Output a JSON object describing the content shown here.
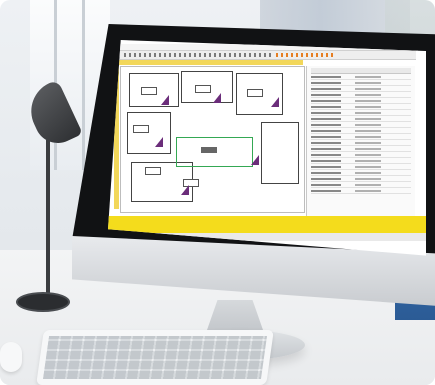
{
  "scene": {
    "subject": "desktop-monitor-photo",
    "accent_colors": {
      "cad_yellow": "#f4dc1c",
      "ruler_yellow": "#f2d75a",
      "room_outline_green": "#34a853",
      "symbol_purple": "#6b2d7a",
      "blue_object": "#3f75b8"
    }
  },
  "screen": {
    "app": "floor-plan-cad",
    "menu_items": [
      "",
      "",
      "",
      "",
      "",
      ""
    ],
    "property_rows": 20
  }
}
